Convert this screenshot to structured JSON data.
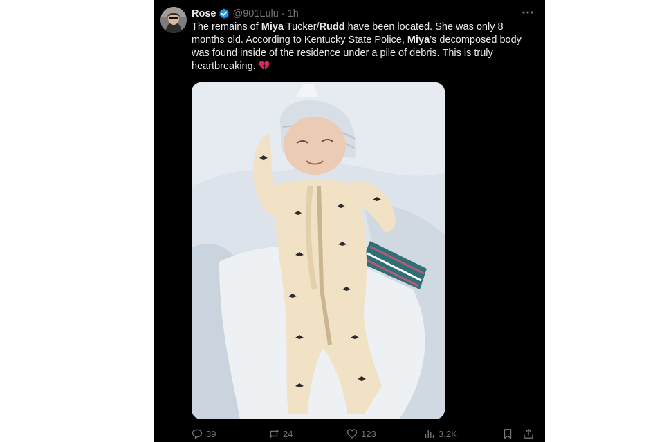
{
  "tweet": {
    "author": {
      "display_name": "Rose",
      "handle": "@901Lulu",
      "separator": "·",
      "timestamp": "1h"
    },
    "text": {
      "s1": "The remains of ",
      "b1": "Miya",
      "s2": " Tucker/",
      "b2": "Rudd",
      "s3": " have been located. She was only 8 months old. According to Kentucky State Police, ",
      "b3": "Miya",
      "s4": "’s decomposed body was found inside of the residence under a pile of debris. This is truly heartbreaking. "
    },
    "stats": {
      "replies": "39",
      "reposts": "24",
      "likes": "123",
      "views": "3.2K"
    }
  },
  "icons": {
    "verified": "verified-badge-icon",
    "more": "more-options-icon",
    "emoji": "broken-heart-icon",
    "reply": "reply-icon",
    "repost": "repost-icon",
    "like": "heart-icon",
    "views": "views-icon",
    "bookmark": "bookmark-icon",
    "share": "share-icon"
  },
  "colors": {
    "background": "#000000",
    "text": "#e7e9ea",
    "secondary": "#71767b",
    "verified": "#1d9bf0",
    "emoji": "#e0245e"
  }
}
